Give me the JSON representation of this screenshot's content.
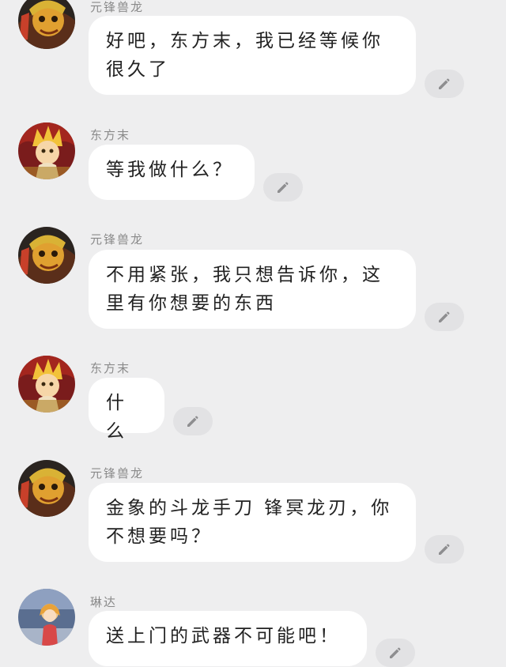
{
  "messages": [
    {
      "sender": "元锋兽龙",
      "text": "好吧，东方末，我已经等候你很久了",
      "avatar": "yuanfeng-avatar"
    },
    {
      "sender": "东方末",
      "text": "等我做什么？",
      "avatar": "dongfangmo-avatar"
    },
    {
      "sender": "元锋兽龙",
      "text": "不用紧张，我只想告诉你，这里有你想要的东西",
      "avatar": "yuanfeng-avatar"
    },
    {
      "sender": "东方末",
      "text": "什么",
      "avatar": "dongfangmo-avatar"
    },
    {
      "sender": "元锋兽龙",
      "text": "金象的斗龙手刀 锋冥龙刃，你不想要吗？",
      "avatar": "yuanfeng-avatar"
    },
    {
      "sender": "琳达",
      "text": "送上门的武器不可能吧！",
      "avatar": "linda-avatar"
    }
  ],
  "icons": {
    "edit": "pencil-icon"
  },
  "colors": {
    "background": "#eeeeef",
    "bubble": "#ffffff",
    "edit_button": "#e2e2e4",
    "name": "#8a8a8a"
  }
}
